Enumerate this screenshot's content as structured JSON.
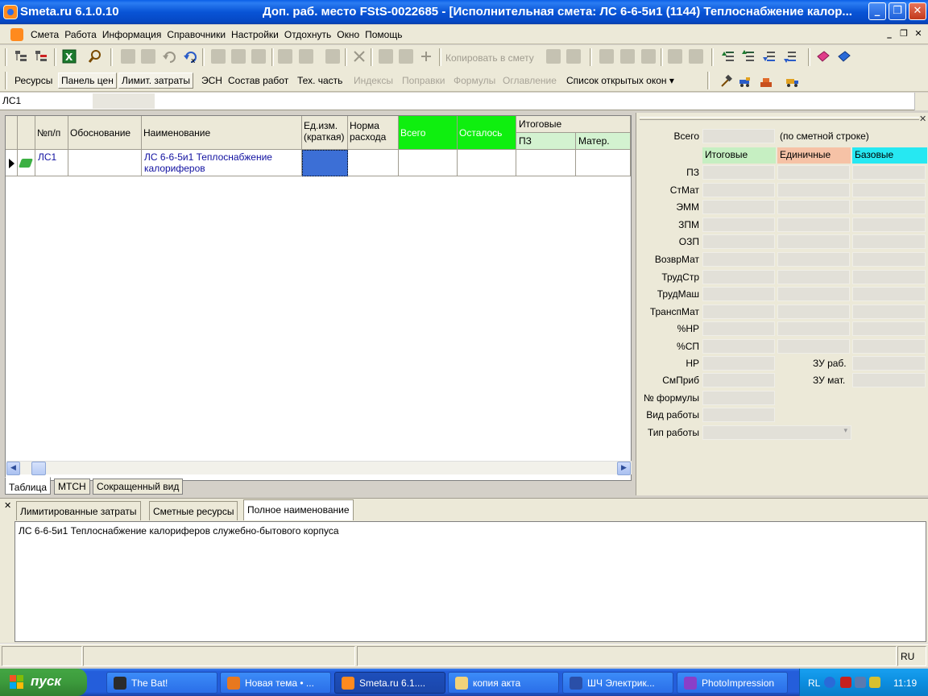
{
  "window": {
    "app_title": "Smeta.ru  6.1.0.10",
    "doc_title": "Доп. раб. место  FStS-0022685 - [Исполнительная смета: ЛС 6-6-5и1 (1144) Теплоснабжение калор...",
    "buttons": {
      "minimize": "_",
      "maximize": "❐",
      "close": "✕"
    }
  },
  "menu": {
    "items": [
      "Смета",
      "Работа",
      "Информация",
      "Справочники",
      "Настройки",
      "Отдохнуть",
      "Окно",
      "Помощь"
    ],
    "mdi": {
      "minimize": "_",
      "restore": "❐",
      "close": "✕"
    }
  },
  "toolbar1": {
    "copy_to_smeta": "Копировать в смету"
  },
  "toolbar2": {
    "items": [
      {
        "label": "Ресурсы",
        "enabled": true,
        "pressed": false
      },
      {
        "label": "Панель цен",
        "enabled": true,
        "pressed": true
      },
      {
        "label": "Лимит. затраты",
        "enabled": true,
        "pressed": true
      },
      {
        "label": "ЭСН",
        "enabled": true,
        "pressed": false
      },
      {
        "label": "Состав работ",
        "enabled": true,
        "pressed": false
      },
      {
        "label": "Тех. часть",
        "enabled": true,
        "pressed": false
      },
      {
        "label": "Индексы",
        "enabled": false,
        "pressed": false
      },
      {
        "label": "Поправки",
        "enabled": false,
        "pressed": false
      },
      {
        "label": "Формулы",
        "enabled": false,
        "pressed": false
      },
      {
        "label": "Оглавление",
        "enabled": false,
        "pressed": false
      },
      {
        "label": "Список открытых окон ▾",
        "enabled": true,
        "pressed": false
      }
    ]
  },
  "ls_field": {
    "value": "ЛС1"
  },
  "grid": {
    "headers": {
      "num": "№п/п",
      "basis": "Обоснование",
      "name": "Наименование",
      "unit": "Ед.изм. (краткая)",
      "norm": "Норма расхода",
      "total": "Всего",
      "remaining": "Осталось",
      "itog": "Итоговые",
      "pz": "ПЗ",
      "mater": "Матер."
    },
    "rows": [
      {
        "num": "ЛС1",
        "basis": "",
        "name": "ЛС 6-6-5и1 Теплоснабжение калориферов",
        "unit": "",
        "norm": "",
        "total": "",
        "remaining": "",
        "pz": "",
        "mater": ""
      }
    ],
    "tabs": [
      "Таблица",
      "МТСН",
      "Сокращенный вид"
    ],
    "active_tab": "Таблица"
  },
  "right_panel": {
    "vsego_label": "Всего",
    "vsego_note": "(по сметной строке)",
    "col_headers": [
      "Итоговые",
      "Единичные",
      "Базовые"
    ],
    "col_colors": [
      "#c6efc2",
      "#f6c2a6",
      "#26e8f2"
    ],
    "rows": [
      "ПЗ",
      "СтМат",
      "ЭММ",
      "ЗПМ",
      "ОЗП",
      "ВозврМат",
      "ТрудСтр",
      "ТрудМаш",
      "ТранспМат",
      "%НР",
      "%СП"
    ],
    "nr_label": "НР",
    "zu_rab_label": "ЗУ раб.",
    "smprib_label": "СмПриб",
    "zu_mat_label": "ЗУ мат.",
    "formula_label": "№ формулы",
    "work_kind_label": "Вид работы",
    "work_type_label": "Тип работы"
  },
  "bottom_panel": {
    "tabs": [
      "Лимитированные затраты",
      "Сметные ресурсы",
      "Полное наименование"
    ],
    "active_tab": "Полное наименование",
    "full_name": "ЛС 6-6-5и1 Теплоснабжение калориферов  служебно-бытового корпуса"
  },
  "statusbar": {
    "lang": "RU"
  },
  "taskbar": {
    "start_label": "пуск",
    "tasks": [
      {
        "label": "The Bat!",
        "icon": "bat-icon",
        "color": "#2b2b2b",
        "active": false
      },
      {
        "label": "Новая тема • ...",
        "icon": "firefox-icon",
        "color": "#e8781e",
        "active": false
      },
      {
        "label": "Smeta.ru  6.1....",
        "icon": "smeta-icon",
        "color": "#ff8a1e",
        "active": true
      },
      {
        "label": "копия акта",
        "icon": "folder-icon",
        "color": "#f2d27a",
        "active": false
      },
      {
        "label": "ШЧ Электрик...",
        "icon": "word-icon",
        "color": "#2a4fa8",
        "active": false
      },
      {
        "label": "PhotoImpression",
        "icon": "photoimpression-icon",
        "color": "#8a3fc8",
        "active": false
      }
    ],
    "tray_lang": "RL",
    "clock": "11:19"
  }
}
